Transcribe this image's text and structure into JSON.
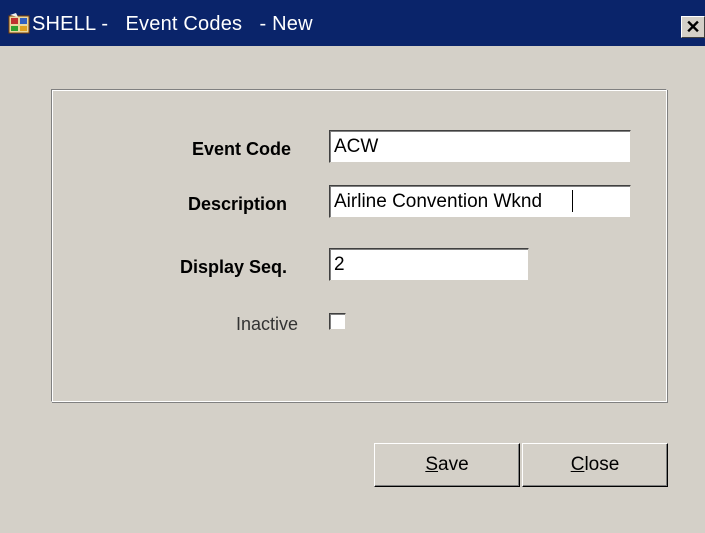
{
  "window": {
    "title": "SHELL -   Event Codes   - New",
    "close_glyph": "✕",
    "app_icon": "shell-app-icon"
  },
  "form": {
    "event_code": {
      "label": "Event Code",
      "value": "ACW"
    },
    "description": {
      "label": "Description",
      "value": "Airline Convention Wknd"
    },
    "display_seq": {
      "label": "Display Seq.",
      "value": "2"
    },
    "inactive": {
      "label": "Inactive",
      "checked": false
    }
  },
  "buttons": {
    "save": {
      "mnemonic": "S",
      "rest": "ave"
    },
    "close": {
      "mnemonic": "C",
      "rest": "lose"
    }
  },
  "colors": {
    "title_bar": "#0a246a",
    "window_face": "#d4d0c8"
  }
}
